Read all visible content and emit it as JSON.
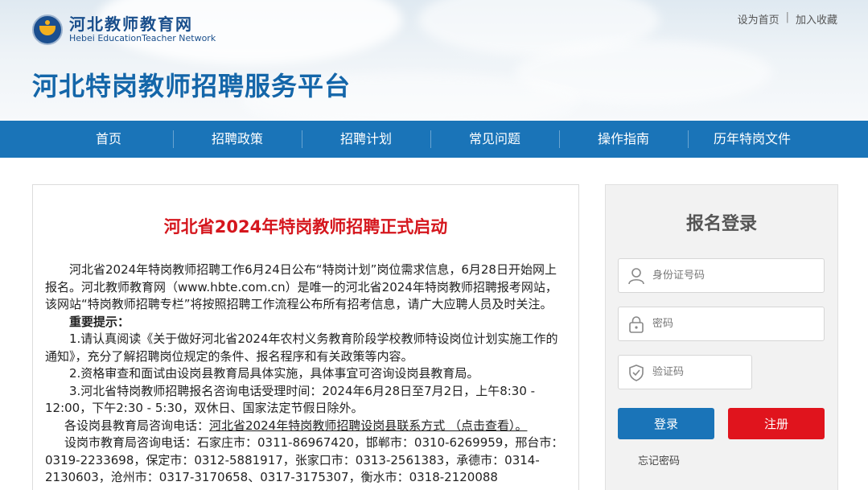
{
  "header": {
    "logo_cn": "河北教师教育网",
    "logo_en": "Hebei EducationTeacher Network",
    "top_links": [
      "设为首页",
      "加入收藏"
    ],
    "separator": "|",
    "platform_title": "河北特岗教师招聘服务平台"
  },
  "nav": {
    "items": [
      "首页",
      "招聘政策",
      "招聘计划",
      "常见问题",
      "操作指南",
      "历年特岗文件"
    ]
  },
  "article": {
    "title": "河北省2024年特岗教师招聘正式启动",
    "intro": "河北省2024年特岗教师招聘工作6月24日公布“特岗计划”岗位需求信息，6月28日开始网上报名。河北教师教育网（www.hbte.com.cn）是唯一的河北省2024年特岗教师招聘报考网站，该网站“特岗教师招聘专栏”将按照招聘工作流程公布所有招考信息，请广大应聘人员及时关注。",
    "notice_heading": "重要提示：",
    "item1": "1.请认真阅读《关于做好河北省2024年农村义务教育阶段学校教师特设岗位计划实施工作的通知》，充分了解招聘岗位规定的条件、报名程序和有关政策等内容。",
    "item2": "2.资格审查和面试由设岗县教育局具体实施，具体事宜可咨询设岗县教育局。",
    "item3": "3.河北省特岗教师招聘报名咨询电话受理时间：2024年6月28日至7月2日，上午8:30 - 12:00，下午2:30 - 5:30，双休日、国家法定节假日除外。",
    "county_prefix": "各设岗县教育局咨询电话：",
    "county_link": "河北省2024年特岗教师招聘设岗县联系方式 （点击查看）。",
    "city_phones": "设岗市教育局咨询电话：石家庄市：0311-86967420，邯郸市：0310-6269959，邢台市：0319-2233698，保定市：0312-5881917，张家口市：0313-2561383，承德市：0314-2130603，沧州市：0317-3170658、0317-3175307，衡水市：0318-2120088"
  },
  "login": {
    "title": "报名登录",
    "id_placeholder": "身份证号码",
    "password_placeholder": "密码",
    "captcha_placeholder": "验证码",
    "login_label": "登录",
    "register_label": "注册",
    "forgot_label": "忘记密码"
  },
  "colors": {
    "brand_blue": "#1a74b8",
    "title_red": "#d5161d",
    "register_red": "#e0141d"
  },
  "icons": {
    "id_field": "user-icon",
    "password_field": "lock-icon",
    "captcha_field": "shield-check-icon"
  }
}
